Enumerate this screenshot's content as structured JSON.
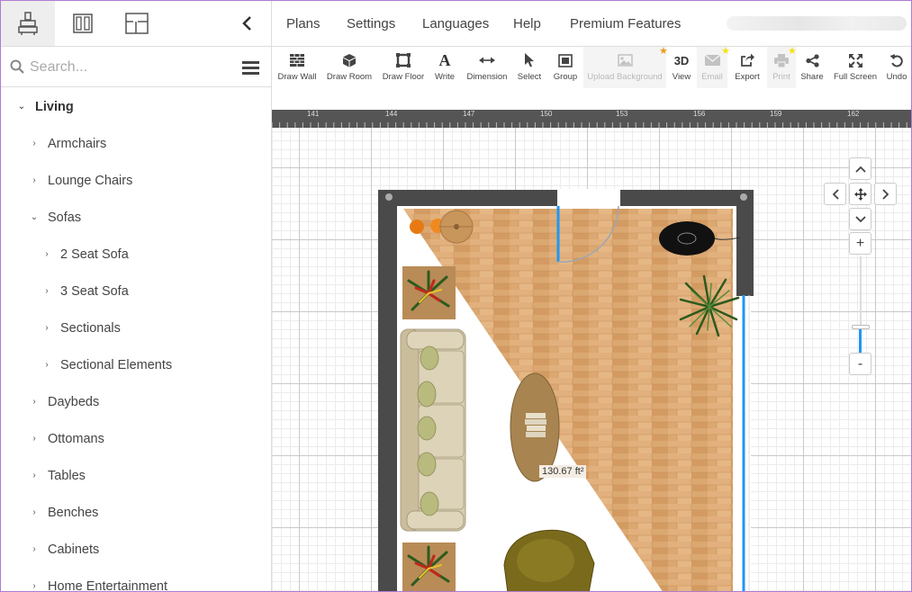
{
  "sidebar": {
    "tabs": [
      {
        "name": "furniture-tab",
        "icon": "furniture-icon",
        "active": true
      },
      {
        "name": "doors-tab",
        "icon": "door-icon",
        "active": false
      },
      {
        "name": "floorplan-tab",
        "icon": "floorplan-icon",
        "active": false
      }
    ],
    "collapse_icon": "chevron-left-icon",
    "search": {
      "placeholder": "Search..."
    },
    "categories": [
      {
        "label": "Living",
        "level": 0,
        "expanded": true
      },
      {
        "label": "Armchairs",
        "level": 1,
        "expanded": false
      },
      {
        "label": "Lounge Chairs",
        "level": 1,
        "expanded": false
      },
      {
        "label": "Sofas",
        "level": 1,
        "expanded": true
      },
      {
        "label": "2 Seat Sofa",
        "level": 2,
        "expanded": false
      },
      {
        "label": "3 Seat Sofa",
        "level": 2,
        "expanded": false
      },
      {
        "label": "Sectionals",
        "level": 2,
        "expanded": false
      },
      {
        "label": "Sectional Elements",
        "level": 2,
        "expanded": false
      },
      {
        "label": "Daybeds",
        "level": 1,
        "expanded": false
      },
      {
        "label": "Ottomans",
        "level": 1,
        "expanded": false
      },
      {
        "label": "Tables",
        "level": 1,
        "expanded": false
      },
      {
        "label": "Benches",
        "level": 1,
        "expanded": false
      },
      {
        "label": "Cabinets",
        "level": 1,
        "expanded": false
      },
      {
        "label": "Home Entertainment",
        "level": 1,
        "expanded": false
      }
    ]
  },
  "topmenu": {
    "items": [
      "Plans",
      "Settings",
      "Languages",
      "Help",
      "Premium Features"
    ]
  },
  "toolbar": {
    "tools": [
      {
        "label": "Draw Wall",
        "icon": "wall-icon",
        "enabled": true
      },
      {
        "label": "Draw Room",
        "icon": "cube-icon",
        "enabled": true
      },
      {
        "label": "Draw Floor",
        "icon": "floor-icon",
        "enabled": true
      },
      {
        "label": "Write",
        "icon": "text-icon",
        "enabled": true
      },
      {
        "label": "Dimension",
        "icon": "dimension-icon",
        "enabled": true
      },
      {
        "label": "Select",
        "icon": "cursor-icon",
        "enabled": true
      },
      {
        "label": "Group",
        "icon": "group-icon",
        "enabled": true
      },
      {
        "label": "Upload Background",
        "icon": "image-icon",
        "enabled": false,
        "premium": "orange"
      },
      {
        "label": "View",
        "icon_text": "3D",
        "icon": "3d-icon",
        "enabled": true
      },
      {
        "label": "Email",
        "icon": "email-icon",
        "enabled": false,
        "premium": "yellow"
      },
      {
        "label": "Export",
        "icon": "export-icon",
        "enabled": true
      },
      {
        "label": "Print",
        "icon": "print-icon",
        "enabled": false,
        "premium": "yellow"
      },
      {
        "label": "Share",
        "icon": "share-icon",
        "enabled": true
      },
      {
        "label": "Full Screen",
        "icon": "fullscreen-icon",
        "enabled": true
      },
      {
        "label": "Undo",
        "icon": "undo-icon",
        "enabled": true
      }
    ]
  },
  "canvas": {
    "ruler_ticks": [
      "141",
      "144",
      "147",
      "150",
      "153",
      "156",
      "159",
      "162"
    ],
    "area_label": "130.67 ft²",
    "zoom_level": 0.25,
    "controls": [
      "chevron-up-icon",
      "chevron-left-icon",
      "move-icon",
      "chevron-right-icon",
      "chevron-down-icon",
      "zoom-in-icon",
      "zoom-out-icon"
    ],
    "zoom_in_symbol": "+",
    "zoom_out_symbol": "-"
  },
  "colors": {
    "wall": "#4a4a4a",
    "floor_wood": "#d9a36b",
    "accent_blue": "#2196f3",
    "frame_border": "#b07bd0"
  }
}
